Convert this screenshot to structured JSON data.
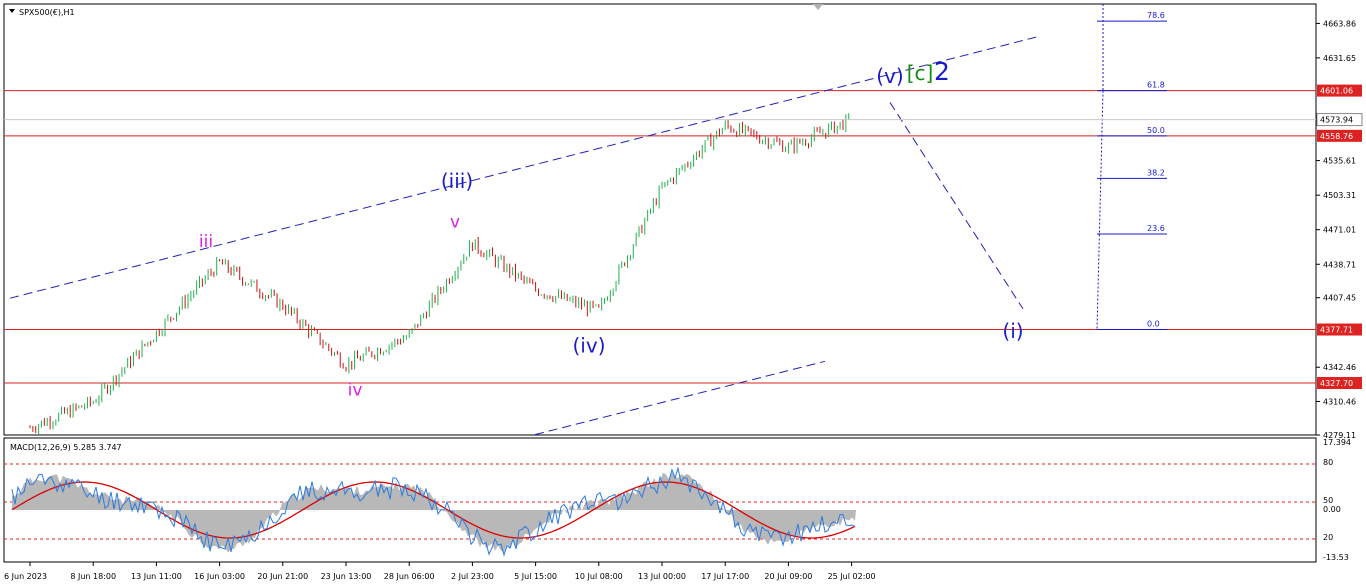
{
  "chart_data": {
    "type": "line",
    "title": "SPX500(€),H1",
    "price_axis": {
      "ticks": [
        4663.86,
        4631.65,
        4535.61,
        4503.31,
        4471.01,
        4438.71,
        4407.45,
        4342.46,
        4310.46,
        4279.11
      ],
      "labels": [
        "4663.86",
        "4631.65",
        "4535.61",
        "4503.31",
        "4471.01",
        "4438.71",
        "4407.45",
        "4342.46",
        "4310.46",
        "4279.11"
      ],
      "current_price": 4573.94,
      "current_price_label": "4573.94",
      "ylim": [
        4279.11,
        4682
      ]
    },
    "price_series": {
      "x": [
        "6 Jun 2023",
        "8 Jun 18:00",
        "13 Jun 11:00",
        "16 Jun 03:00",
        "20 Jun 21:00",
        "23 Jun 13:00",
        "28 Jun 06:00",
        "2 Jul 23:00",
        "5 Jul 15:00",
        "10 Jul 08:00",
        "13 Jul 00:00",
        "17 Jul 17:00",
        "20 Jul 09:00",
        "25 Jul 02:00"
      ],
      "y": [
        4286,
        4310,
        4375,
        4440,
        4400,
        4345,
        4372,
        4458,
        4415,
        4395,
        4510,
        4568,
        4548,
        4574
      ]
    },
    "horizontal_levels": [
      {
        "value": 4601.06,
        "label": "4601.06"
      },
      {
        "value": 4558.76,
        "label": "4558.76"
      },
      {
        "value": 4377.71,
        "label": "4377.71"
      },
      {
        "value": 4327.7,
        "label": "4327.70"
      }
    ],
    "fibonacci": [
      {
        "level": "78.6",
        "price": 4666
      },
      {
        "level": "61.8",
        "price": 4601.06
      },
      {
        "level": "50.0",
        "price": 4558.76
      },
      {
        "level": "38.2",
        "price": 4519
      },
      {
        "level": "23.6",
        "price": 4467
      },
      {
        "level": "0.0",
        "price": 4377.71
      }
    ],
    "wave_labels": [
      {
        "text": "iii",
        "color": "#e020e0",
        "date": "16 Jun 03:00",
        "price": 4455
      },
      {
        "text": "iv",
        "color": "#e020e0",
        "date": "23 Jun 13:00",
        "price": 4316
      },
      {
        "text": "v",
        "color": "#e020e0",
        "date": "2 Jul 23:00",
        "price": 4473
      },
      {
        "text": "(iii)",
        "color": "#1a1acc",
        "date": "2 Jul 23:00",
        "price": 4510
      },
      {
        "text": "(iv)",
        "color": "#1a1acc",
        "date": "10 Jul 08:00",
        "price": 4356
      },
      {
        "text": "(v)",
        "color": "#1a1acc",
        "date": "25 Jul 02:00",
        "price": 4608
      },
      {
        "text": "[c]",
        "color": "#138a13",
        "date": "25 Jul 02:00",
        "price": 4611
      },
      {
        "text": "2",
        "color": "#1a1acc",
        "date": "25 Jul 02:00",
        "price": 4611
      },
      {
        "text": "(i)",
        "color": "#1a1acc",
        "date": "27 Jul",
        "price": 4370
      }
    ],
    "macd": {
      "title": "MACD(12,26,9) 5.285 3.747",
      "right_labels": [
        "17.394",
        "80",
        "50",
        "0.00",
        "20",
        "-13.53"
      ],
      "levels": [
        80,
        50,
        20
      ],
      "ylim": [
        -13.53,
        17.394
      ]
    },
    "x_axis": {
      "labels": [
        "6 Jun 2023",
        "8 Jun 18:00",
        "13 Jun 11:00",
        "16 Jun 03:00",
        "20 Jun 21:00",
        "23 Jun 13:00",
        "28 Jun 06:00",
        "2 Jul 23:00",
        "5 Jul 15:00",
        "10 Jul 08:00",
        "13 Jul 00:00",
        "17 Jul 17:00",
        "20 Jul 09:00",
        "25 Jul 02:00"
      ]
    },
    "colors": {
      "bull": "#22b14c",
      "bear": "#cc1111",
      "level_line": "#dd2222",
      "channel": "#2222bb",
      "fib": "#1a1acc",
      "macd_hist": "#b8b8b8",
      "macd_signal": "#dd0000",
      "rsi_line": "#2a7be0"
    }
  }
}
